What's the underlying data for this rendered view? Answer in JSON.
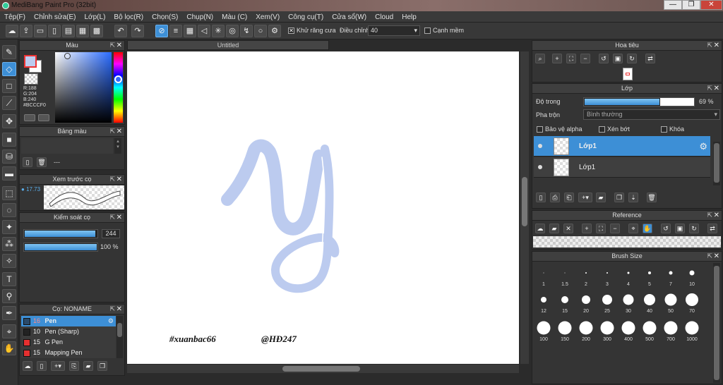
{
  "window": {
    "title": "MediBang Paint Pro (32bit)",
    "min": "—",
    "max": "❐",
    "close": "✕"
  },
  "menu": [
    "Tệp(F)",
    "Chỉnh sửa(E)",
    "Lớp(L)",
    "Bộ lọc(R)",
    "Chọn(S)",
    "Chụp(N)",
    "Màu (C)",
    "Xem(V)",
    "Công cụ(T)",
    "Cửa sổ(W)",
    "Cloud",
    "Help"
  ],
  "toolbar": {
    "antialias_label": "Khử răng cưa",
    "adjust_label": "Điều chỉnh",
    "adjust_value": "40",
    "smooth_edge_label": "Cạnh mềm"
  },
  "color_panel": {
    "title": "Màu",
    "r": "R:188",
    "g": "G:204",
    "b": "B:240",
    "hex": "#BCCCF0",
    "fg": "#bcccf0",
    "bg": "#ffffff"
  },
  "palette_panel": {
    "title": "Bảng màu",
    "value": "---"
  },
  "brush_preview_panel": {
    "title": "Xem trước cọ",
    "size": "17.73"
  },
  "brush_control_panel": {
    "title": "Kiểm soát cọ",
    "size_value": "244",
    "opacity_value": "100 %",
    "size_fraction": 0.98,
    "opacity_fraction": 1.0
  },
  "brush_list_panel": {
    "title": "Cọ: NONAME",
    "items": [
      {
        "num": "16",
        "name": "Pen",
        "color": "#2a4a6a",
        "selected": true
      },
      {
        "num": "10",
        "name": "Pen (Sharp)",
        "color": "#222222",
        "selected": false
      },
      {
        "num": "15",
        "name": "G Pen",
        "color": "#e53030",
        "selected": false
      },
      {
        "num": "15",
        "name": "Mapping Pen",
        "color": "#e53030",
        "selected": false
      }
    ]
  },
  "canvas": {
    "tab": "Untitled",
    "letter": "y",
    "letter_color": "#bccbef",
    "watermark_left": "#xuanbac66",
    "watermark_right": "@HĐ247"
  },
  "navigator_panel": {
    "title": "Hoa tiêu"
  },
  "layer_panel": {
    "title": "Lớp",
    "opacity_label": "Độ trong",
    "opacity_value": "69 %",
    "opacity_fraction": 0.69,
    "blend_label": "Pha trộn",
    "blend_value": "Bình thường",
    "protect_alpha": "Bảo vệ alpha",
    "clipping": "Xén bớt",
    "lock": "Khóa",
    "layers": [
      {
        "name": "Lớp1",
        "selected": true
      },
      {
        "name": "Lớp1",
        "selected": false
      }
    ]
  },
  "reference_panel": {
    "title": "Reference"
  },
  "brush_size_panel": {
    "title": "Brush Size",
    "sizes": [
      "1",
      "1.5",
      "2",
      "3",
      "4",
      "5",
      "7",
      "10",
      "12",
      "15",
      "20",
      "25",
      "30",
      "40",
      "50",
      "70",
      "100",
      "150",
      "200",
      "300",
      "400",
      "500",
      "700",
      "1000"
    ]
  },
  "colors": {
    "accent": "#3d8fd6",
    "panel": "#343434",
    "dark": "#2b2b2b"
  }
}
